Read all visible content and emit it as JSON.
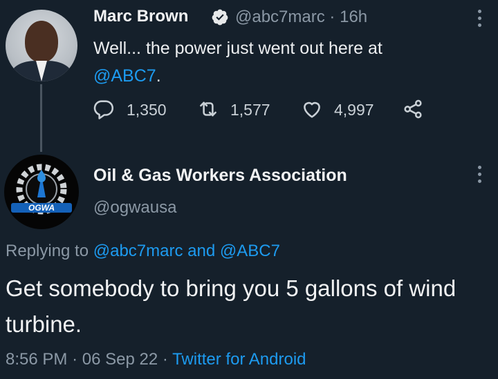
{
  "tweet": {
    "author_name": "Marc Brown",
    "author_handle": "@abc7marc",
    "separator": "·",
    "time": "16h",
    "text_prefix": "Well... the power just went out here at",
    "mention": "@ABC7",
    "text_suffix": ".",
    "stats": {
      "replies": "1,350",
      "retweets": "1,577",
      "likes": "4,997"
    }
  },
  "reply": {
    "author_name": "Oil & Gas Workers Association",
    "author_handle": "@ogwausa",
    "avatar_logo_text": "OGWA",
    "replying_label": "Replying to",
    "replying_user1": "@abc7marc",
    "replying_and": "and",
    "replying_user2": "@ABC7",
    "text": "Get somebody to bring you 5 gallons of wind turbine.",
    "time": "8:56 PM",
    "date": "06 Sep 22",
    "source": "Twitter for Android",
    "separator": "·"
  },
  "icons": {
    "verified": "verified-badge-icon",
    "more": "more-options-icon",
    "reply": "reply-icon",
    "retweet": "retweet-icon",
    "like": "heart-icon",
    "share": "share-icon"
  },
  "colors": {
    "background": "#15202b",
    "link": "#1d9bf0",
    "muted": "#8b98a5"
  }
}
